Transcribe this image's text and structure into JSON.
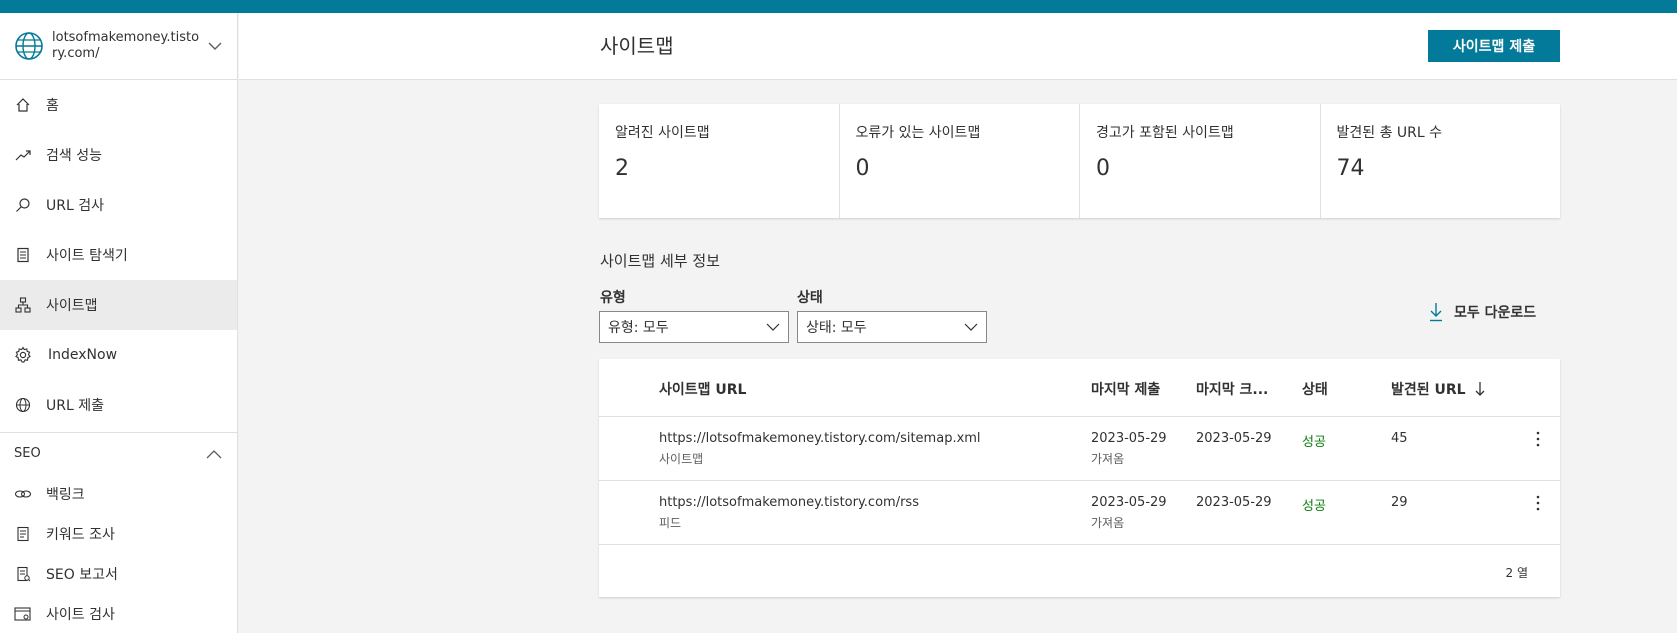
{
  "colors": {
    "brand": "#037a99",
    "success": "#107c10"
  },
  "site": {
    "name": "lotsofmakemoney.tistory.com/"
  },
  "nav": [
    {
      "label": "홈",
      "icon": "home-icon"
    },
    {
      "label": "검색 성능",
      "icon": "trend-icon"
    },
    {
      "label": "URL 검사",
      "icon": "search-icon"
    },
    {
      "label": "사이트 탐색기",
      "icon": "document-list-icon"
    },
    {
      "label": "사이트맵",
      "icon": "sitemap-icon",
      "active": true
    },
    {
      "label": "IndexNow",
      "icon": "gear-icon"
    },
    {
      "label": "URL 제출",
      "icon": "globe-icon"
    }
  ],
  "seo": {
    "label": "SEO",
    "items": [
      {
        "label": "백링크",
        "icon": "link-icon"
      },
      {
        "label": "키워드 조사",
        "icon": "document-icon"
      },
      {
        "label": "SEO 보고서",
        "icon": "report-icon"
      },
      {
        "label": "사이트 검사",
        "icon": "scan-icon"
      }
    ]
  },
  "header": {
    "title": "사이트맵",
    "submit_label": "사이트맵 제출"
  },
  "stats": [
    {
      "label": "알려진 사이트맵",
      "value": "2"
    },
    {
      "label": "오류가 있는 사이트맵",
      "value": "0"
    },
    {
      "label": "경고가 포함된 사이트맵",
      "value": "0"
    },
    {
      "label": "발견된 총 URL 수",
      "value": "74"
    }
  ],
  "details": {
    "title": "사이트맵 세부 정보",
    "type_filter": {
      "label": "유형",
      "value": "유형: 모두"
    },
    "status_filter": {
      "label": "상태",
      "value": "상태: 모두"
    },
    "download_label": "모두 다운로드"
  },
  "table": {
    "columns": [
      "사이트맵 URL",
      "마지막 제출",
      "마지막 크...",
      "상태",
      "발견된 URL"
    ],
    "rows": [
      {
        "url": "https://lotsofmakemoney.tistory.com/sitemap.xml",
        "type": "사이트맵",
        "submitted": "2023-05-29",
        "submitted_sub": "가져옴",
        "crawled": "2023-05-29",
        "status": "성공",
        "urls": "45"
      },
      {
        "url": "https://lotsofmakemoney.tistory.com/rss",
        "type": "피드",
        "submitted": "2023-05-29",
        "submitted_sub": "가져옴",
        "crawled": "2023-05-29",
        "status": "성공",
        "urls": "29"
      }
    ],
    "row_count": "2 열"
  }
}
